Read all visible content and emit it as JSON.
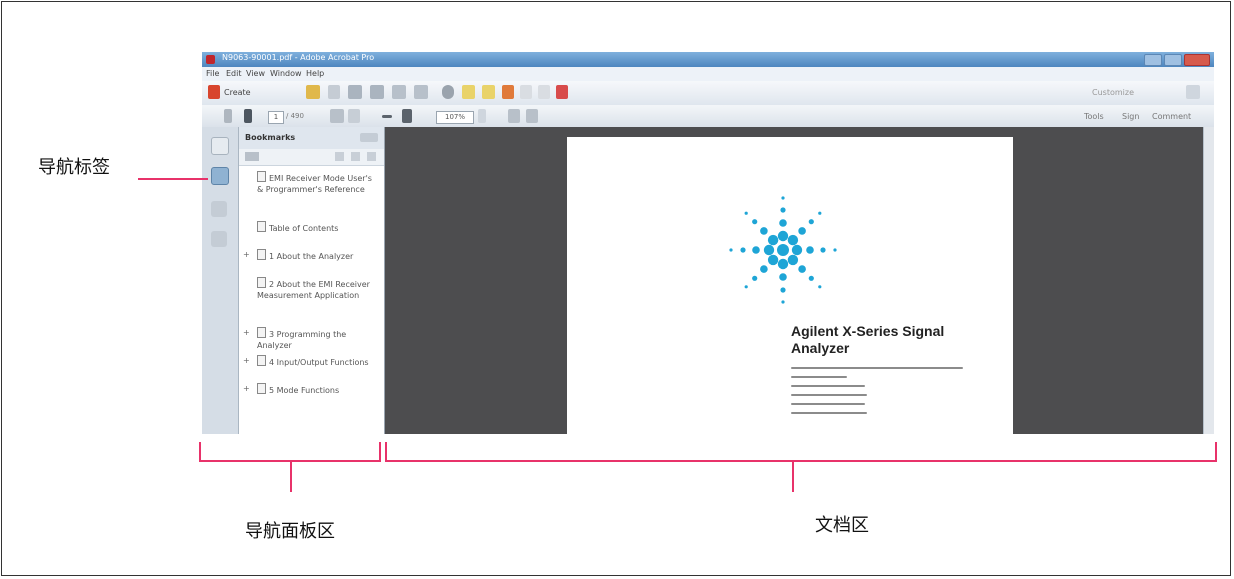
{
  "labels": {
    "nav_tabs": "导航标签",
    "nav_panel": "导航面板区",
    "doc_area": "文档区"
  },
  "acrobat": {
    "window_title": "N9063-90001.pdf - Adobe Acrobat Pro",
    "menu": [
      "File",
      "Edit",
      "View",
      "Window",
      "Help"
    ],
    "create_label": "Create",
    "customize_label": "Customize",
    "page_number": "1",
    "page_total": "/ 490",
    "zoom_value": "107%",
    "right_tabs": [
      "Tools",
      "Sign",
      "Comment"
    ],
    "panel_title": "Bookmarks",
    "bookmarks": [
      {
        "text": "EMI Receiver Mode User's & Programmer's Reference",
        "expandable": false
      },
      {
        "text": "Table of Contents",
        "expandable": false
      },
      {
        "text": "1 About the Analyzer",
        "expandable": true
      },
      {
        "text": "2 About the EMI Receiver Measurement Application",
        "expandable": false
      },
      {
        "text": "3 Programming the Analyzer",
        "expandable": true
      },
      {
        "text": "4 Input/Output Functions",
        "expandable": true
      },
      {
        "text": "5 Mode Functions",
        "expandable": true
      }
    ],
    "doc_title": "Agilent X-Series Signal Analyzer",
    "logo_color": "#1ea5d6"
  },
  "colors": {
    "annotation": "#e8326a",
    "doc_background": "#4d4d4f"
  }
}
